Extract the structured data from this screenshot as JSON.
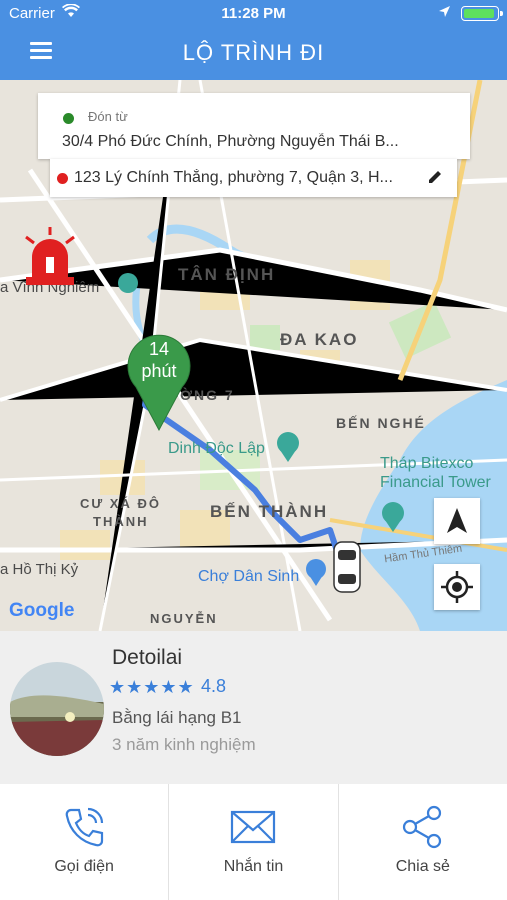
{
  "status_bar": {
    "carrier": "Carrier",
    "time": "11:28 PM"
  },
  "nav": {
    "title": "LỘ TRÌNH ĐI"
  },
  "route": {
    "pickup_label": "Đón từ",
    "pickup_address": "30/4 Phó Đức Chính,  Phường Nguyễn Thái B...",
    "dropoff_address": "123 Lý Chính Thắng, phường 7, Quận 3, H...",
    "eta_value": "14",
    "eta_unit": "phút"
  },
  "map": {
    "labels": {
      "tan_dinh": "TÂN ĐỊNH",
      "da_kao": "ĐA KAO",
      "phuong_7": "PHƯỜNG 7",
      "ben_nghe": "BẾN NGHÉ",
      "ben_thanh": "BẾN THÀNH",
      "cu_xa_1": "CƯ XÁ ĐÔ",
      "cu_xa_2": "THÀNH",
      "nguyen": "NGUYỄN",
      "dinh_doc_lap": "Dinh Độc Lập",
      "bitexco_1": "Tháp Bitexco",
      "bitexco_2": "Financial Tower",
      "cho_dan_sinh": "Chợ Dân Sinh",
      "vinh_nghiem": "a Vĩnh Nghiêm",
      "ho_thi_ky": "a Hồ Thị Kỷ",
      "ham_thu_thiem": "Hầm Thủ Thiêm"
    },
    "google_logo": "Google"
  },
  "driver": {
    "name": "Detoilai",
    "stars": "★★★★★",
    "rating": "4.8",
    "license": "Bằng lái hạng B1",
    "experience": "3 năm kinh nghiệm"
  },
  "actions": [
    {
      "label": "Gọi điện",
      "icon": "phone-icon"
    },
    {
      "label": "Nhắn tin",
      "icon": "mail-icon"
    },
    {
      "label": "Chia sẻ",
      "icon": "share-icon"
    }
  ],
  "colors": {
    "header": "#4a90e2",
    "accent": "#3a7fd9",
    "route": "#4a7fe0",
    "pin": "#3a9a4a"
  }
}
